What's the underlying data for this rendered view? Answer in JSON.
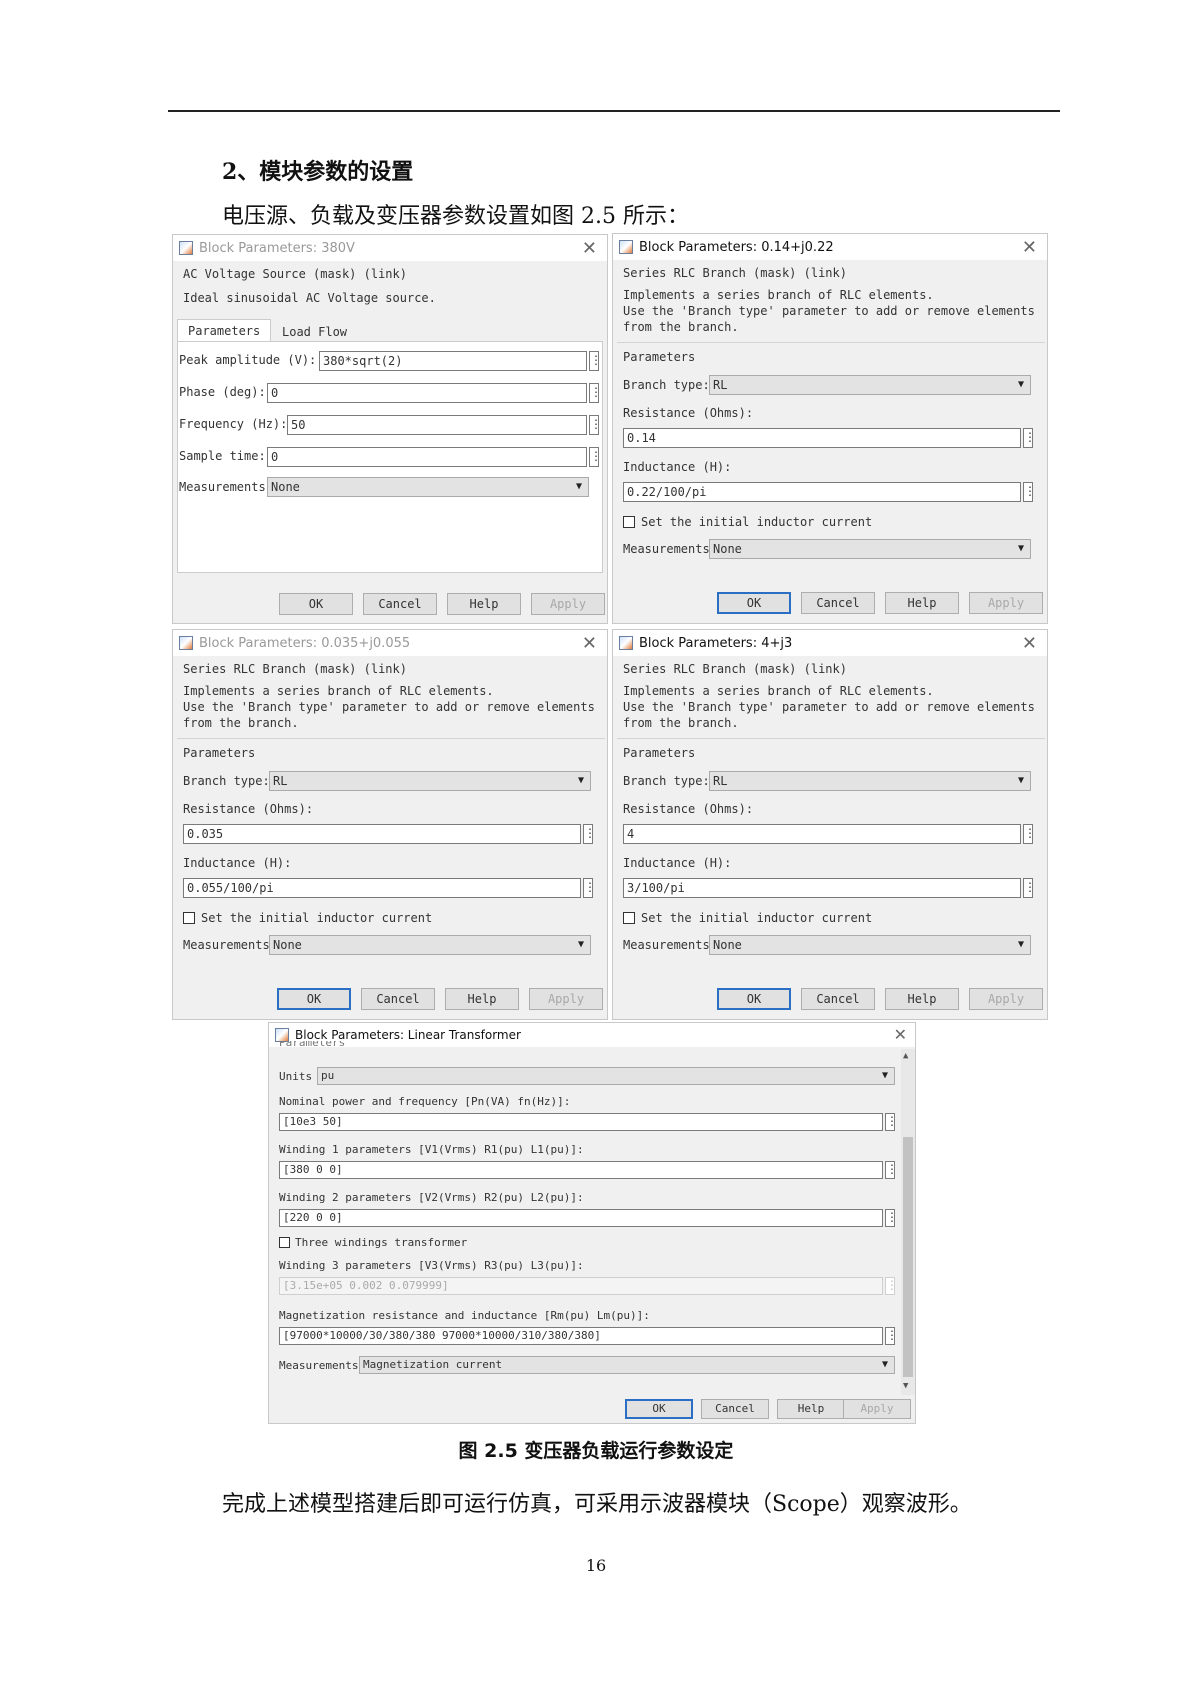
{
  "heading": "2、模块参数的设置",
  "intro": "电压源、负载及变压器参数设置如图 2.5 所示：",
  "dialogs": {
    "ac": {
      "title": "Block Parameters: 380V",
      "mask_title": "AC Voltage Source (mask) (link)",
      "description": "Ideal sinusoidal AC Voltage source.",
      "tab_parameters": "Parameters",
      "tab_loadflow": "Load Flow",
      "peak_label": "Peak amplitude (V):",
      "peak_value": "380*sqrt(2)",
      "phase_label": "Phase (deg):",
      "phase_value": "0",
      "freq_label": "Frequency (Hz):",
      "freq_value": "50",
      "sample_label": "Sample time:",
      "sample_value": "0",
      "meas_label": "Measurements",
      "meas_value": "None",
      "ok": "OK",
      "cancel": "Cancel",
      "help": "Help",
      "apply": "Apply"
    },
    "rlc1": {
      "title": "Block Parameters: 0.14+j0.22",
      "mask_title": "Series RLC Branch (mask) (link)",
      "desc1": "Implements a series branch of RLC elements.",
      "desc2": "Use the 'Branch type' parameter to add or remove elements",
      "desc3": "from the branch.",
      "params": "Parameters",
      "branch_label": "Branch type:",
      "branch_value": "RL",
      "res_label": "Resistance (Ohms):",
      "res_value": "0.14",
      "ind_label": "Inductance (H):",
      "ind_value": "0.22/100/pi",
      "init_label": "Set the initial inductor current",
      "meas_label": "Measurements",
      "meas_value": "None",
      "ok": "OK",
      "cancel": "Cancel",
      "help": "Help",
      "apply": "Apply"
    },
    "rlc2": {
      "title": "Block Parameters: 0.035+j0.055",
      "mask_title": "Series RLC Branch (mask) (link)",
      "desc1": "Implements a series branch of RLC elements.",
      "desc2": "Use the 'Branch type' parameter to add or remove elements",
      "desc3": "from the branch.",
      "params": "Parameters",
      "branch_label": "Branch type:",
      "branch_value": "RL",
      "res_label": "Resistance (Ohms):",
      "res_value": "0.035",
      "ind_label": "Inductance (H):",
      "ind_value": "0.055/100/pi",
      "init_label": "Set the initial inductor current",
      "meas_label": "Measurements",
      "meas_value": "None",
      "ok": "OK",
      "cancel": "Cancel",
      "help": "Help",
      "apply": "Apply"
    },
    "rlc3": {
      "title": "Block Parameters: 4+j3",
      "mask_title": "Series RLC Branch (mask) (link)",
      "desc1": "Implements a series branch of RLC elements.",
      "desc2": "Use the 'Branch type' parameter to add or remove elements",
      "desc3": "from the branch.",
      "params": "Parameters",
      "branch_label": "Branch type:",
      "branch_value": "RL",
      "res_label": "Resistance (Ohms):",
      "res_value": "4",
      "ind_label": "Inductance (H):",
      "ind_value": "3/100/pi",
      "init_label": "Set the initial inductor current",
      "meas_label": "Measurements",
      "meas_value": "None",
      "ok": "OK",
      "cancel": "Cancel",
      "help": "Help",
      "apply": "Apply"
    },
    "xfmr": {
      "title": "Block Parameters: Linear Transformer",
      "params_partial": "Parameters",
      "units_label": "Units",
      "units_value": "pu",
      "nom_label": "Nominal power and frequency [Pn(VA) fn(Hz)]:",
      "nom_value": "[10e3 50]",
      "w1_label": "Winding 1 parameters [V1(Vrms) R1(pu) L1(pu)]:",
      "w1_value": "[380 0 0]",
      "w2_label": "Winding 2 parameters [V2(Vrms) R2(pu) L2(pu)]:",
      "w2_value": "[220 0 0]",
      "three_label": "Three windings transformer",
      "w3_label": "Winding 3 parameters [V3(Vrms) R3(pu) L3(pu)]:",
      "w3_value": "[3.15e+05 0.002 0.079999]",
      "mag_label": "Magnetization resistance and inductance [Rm(pu) Lm(pu)]:",
      "mag_value": "[97000*10000/30/380/380 97000*10000/310/380/380]",
      "meas_label": "Measurements",
      "meas_value": "Magnetization current",
      "ok": "OK",
      "cancel": "Cancel",
      "help": "Help",
      "apply": "Apply"
    }
  },
  "icons": {
    "close": "close-icon",
    "dots": "ellipsis-icon",
    "dropdown": "chevron-down-icon"
  },
  "caption": "图 2.5  变压器负载运行参数设定",
  "closing": "完成上述模型搭建后即可运行仿真，可采用示波器模块（Scope）观察波形。",
  "page_number": "16"
}
